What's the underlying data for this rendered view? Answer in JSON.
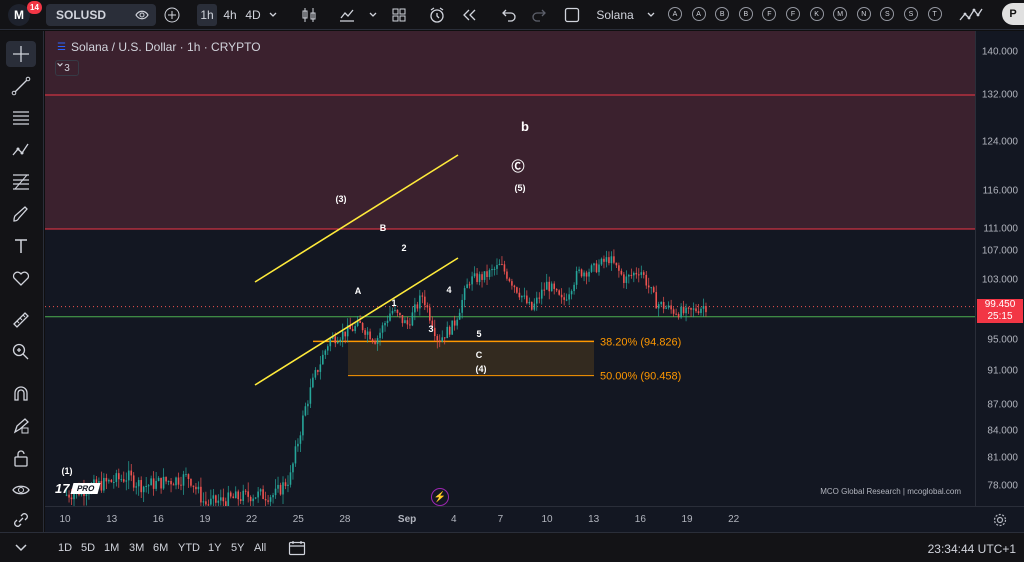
{
  "topbar": {
    "notif_count": "14",
    "symbol": "SOLUSD",
    "timeframes": [
      "1h",
      "4h",
      "4D"
    ],
    "active_timeframe": "1h",
    "layout_name": "Solana",
    "alert_letters": [
      "A",
      "A",
      "B",
      "B",
      "F",
      "F",
      "K",
      "M",
      "N",
      "S",
      "S",
      "T"
    ],
    "pub_label": "P"
  },
  "legend": {
    "title": "Solana / U.S. Dollar · 1h · CRYPTO",
    "indicator_count": "3"
  },
  "watermark": "MCO Global Research | mcoglobal.com",
  "tv_badge": "PRO",
  "colors": {
    "bg": "#131722",
    "resistance_zone": "#4a2533",
    "resistance_line": "#f23645",
    "channel": "#ffeb3b",
    "fib": "#ff9800",
    "fib_zone": "#3a2e1f",
    "support_line": "#4caf50",
    "up": "#26a69a",
    "down": "#ef5350"
  },
  "price_axis": {
    "labels": [
      "140.000",
      "132.000",
      "124.000",
      "116.000",
      "111.000",
      "107.000",
      "103.000",
      "95.000",
      "91.000",
      "87.000",
      "84.000",
      "81.000",
      "78.000"
    ],
    "current_price": "99.450",
    "countdown": "25:15"
  },
  "time_axis": {
    "labels": [
      "10",
      "13",
      "16",
      "19",
      "22",
      "25",
      "28",
      "Sep",
      "4",
      "7",
      "10",
      "13",
      "16",
      "19",
      "22"
    ]
  },
  "fib_levels": [
    {
      "label": "38.20% (94.826)"
    },
    {
      "label": "50.00% (90.458)"
    }
  ],
  "wave_labels": {
    "w1": "(1)",
    "w3": "(3)",
    "wB": "B",
    "w2": "2",
    "wA": "A",
    "w1s": "1",
    "w4": "4",
    "w3s": "3",
    "w5s": "5",
    "wC": "C",
    "w4p": "(4)",
    "wb": "b",
    "wCc": "Ⓒ",
    "w5p": "(5)"
  },
  "bottombar": {
    "ranges": [
      "1D",
      "5D",
      "1M",
      "3M",
      "6M",
      "YTD",
      "1Y",
      "5Y",
      "All"
    ],
    "clock": "23:34:44 UTC+1"
  },
  "chart_data": {
    "type": "candlestick",
    "title": "Solana / U.S. Dollar · 1h · CRYPTO",
    "price_range": [
      75,
      145
    ],
    "x_labels": [
      "10",
      "13",
      "16",
      "19",
      "22",
      "25",
      "28",
      "Sep",
      "4",
      "7",
      "10",
      "13",
      "16",
      "19",
      "22"
    ],
    "path": [
      [
        0,
        77
      ],
      [
        4,
        79
      ],
      [
        5,
        78
      ],
      [
        8,
        79
      ],
      [
        9,
        76
      ],
      [
        12,
        77
      ],
      [
        13.5,
        77
      ],
      [
        14.5,
        79
      ],
      [
        15.5,
        87
      ],
      [
        16,
        90
      ],
      [
        17,
        95
      ],
      [
        18,
        96
      ],
      [
        19,
        97
      ],
      [
        20,
        95
      ],
      [
        21,
        99
      ],
      [
        22,
        97
      ],
      [
        23,
        101
      ],
      [
        24,
        95
      ],
      [
        25,
        97
      ],
      [
        26,
        103
      ],
      [
        27,
        103.5
      ],
      [
        28,
        105
      ],
      [
        29,
        102
      ],
      [
        30,
        99
      ],
      [
        31,
        102.5
      ],
      [
        32,
        100
      ],
      [
        33,
        104
      ],
      [
        34,
        104.5
      ],
      [
        35,
        106
      ],
      [
        36,
        103
      ],
      [
        37,
        104.5
      ],
      [
        38,
        100
      ],
      [
        39,
        99
      ],
      [
        40,
        98.5
      ],
      [
        41,
        99.5
      ]
    ]
  }
}
